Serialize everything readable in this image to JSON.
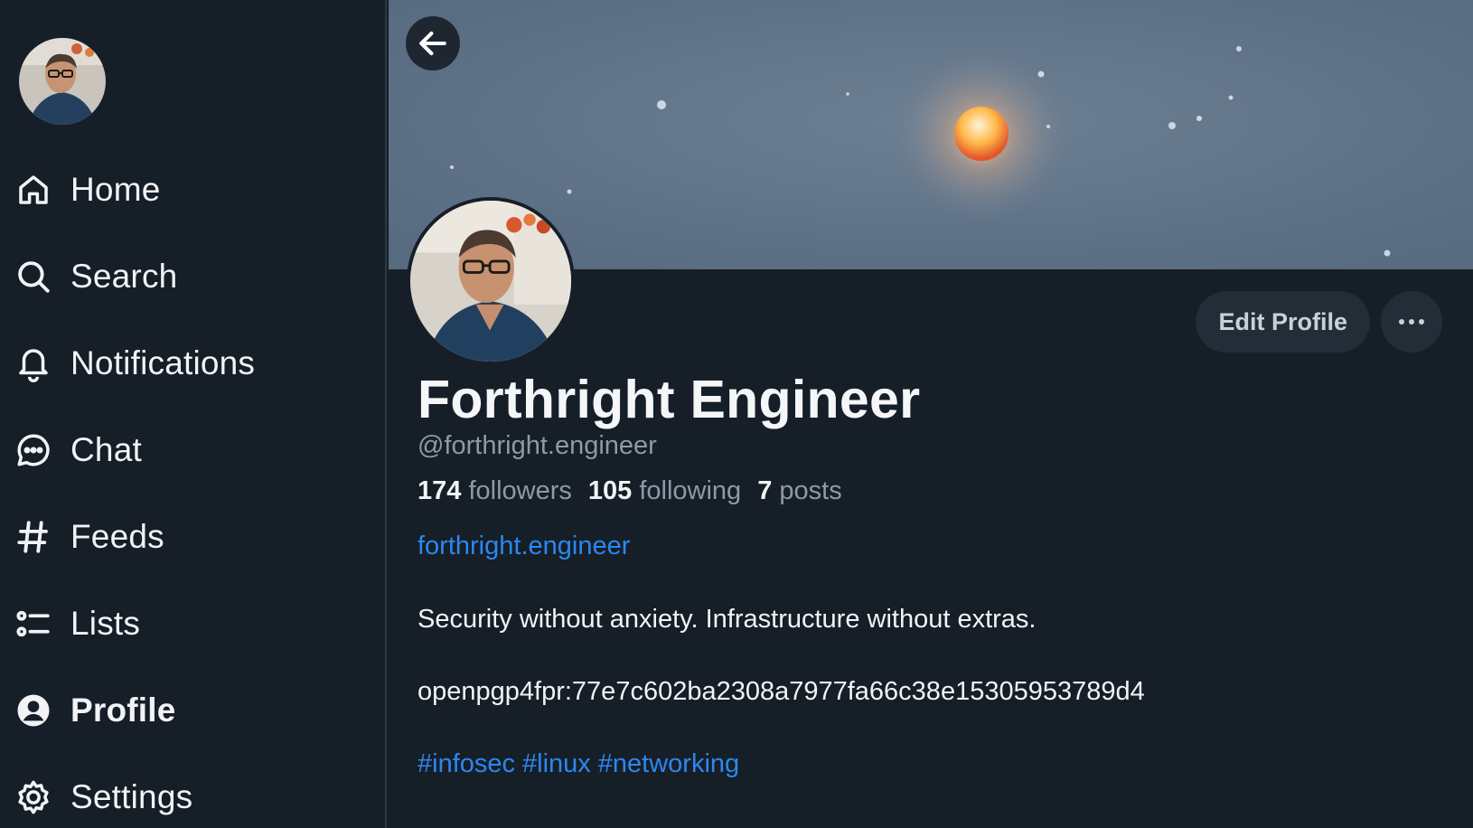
{
  "sidebar": {
    "nav": [
      {
        "id": "home",
        "label": "Home",
        "icon": "home-icon"
      },
      {
        "id": "search",
        "label": "Search",
        "icon": "search-icon"
      },
      {
        "id": "notifications",
        "label": "Notifications",
        "icon": "bell-icon"
      },
      {
        "id": "chat",
        "label": "Chat",
        "icon": "chat-bubble-icon"
      },
      {
        "id": "feeds",
        "label": "Feeds",
        "icon": "hash-icon"
      },
      {
        "id": "lists",
        "label": "Lists",
        "icon": "list-icon"
      },
      {
        "id": "profile",
        "label": "Profile",
        "icon": "user-circle-icon",
        "active": true
      },
      {
        "id": "settings",
        "label": "Settings",
        "icon": "gear-icon"
      }
    ]
  },
  "profile": {
    "display_name": "Forthright Engineer",
    "handle": "@forthright.engineer",
    "followers_count": "174",
    "followers_label": "followers",
    "following_count": "105",
    "following_label": "following",
    "posts_count": "7",
    "posts_label": "posts",
    "website": "forthright.engineer",
    "bio_line1": "Security without anxiety. Infrastructure without extras.",
    "bio_line2": "openpgp4fpr:77e7c602ba2308a7977fa66c38e15305953789d4",
    "hashtags": [
      "#infosec",
      "#linux",
      "#networking"
    ]
  },
  "actions": {
    "edit_label": "Edit Profile"
  },
  "colors": {
    "background": "#161e27",
    "accent": "#2b88ef",
    "muted": "#8d9aa8",
    "banner": "#596d83"
  }
}
